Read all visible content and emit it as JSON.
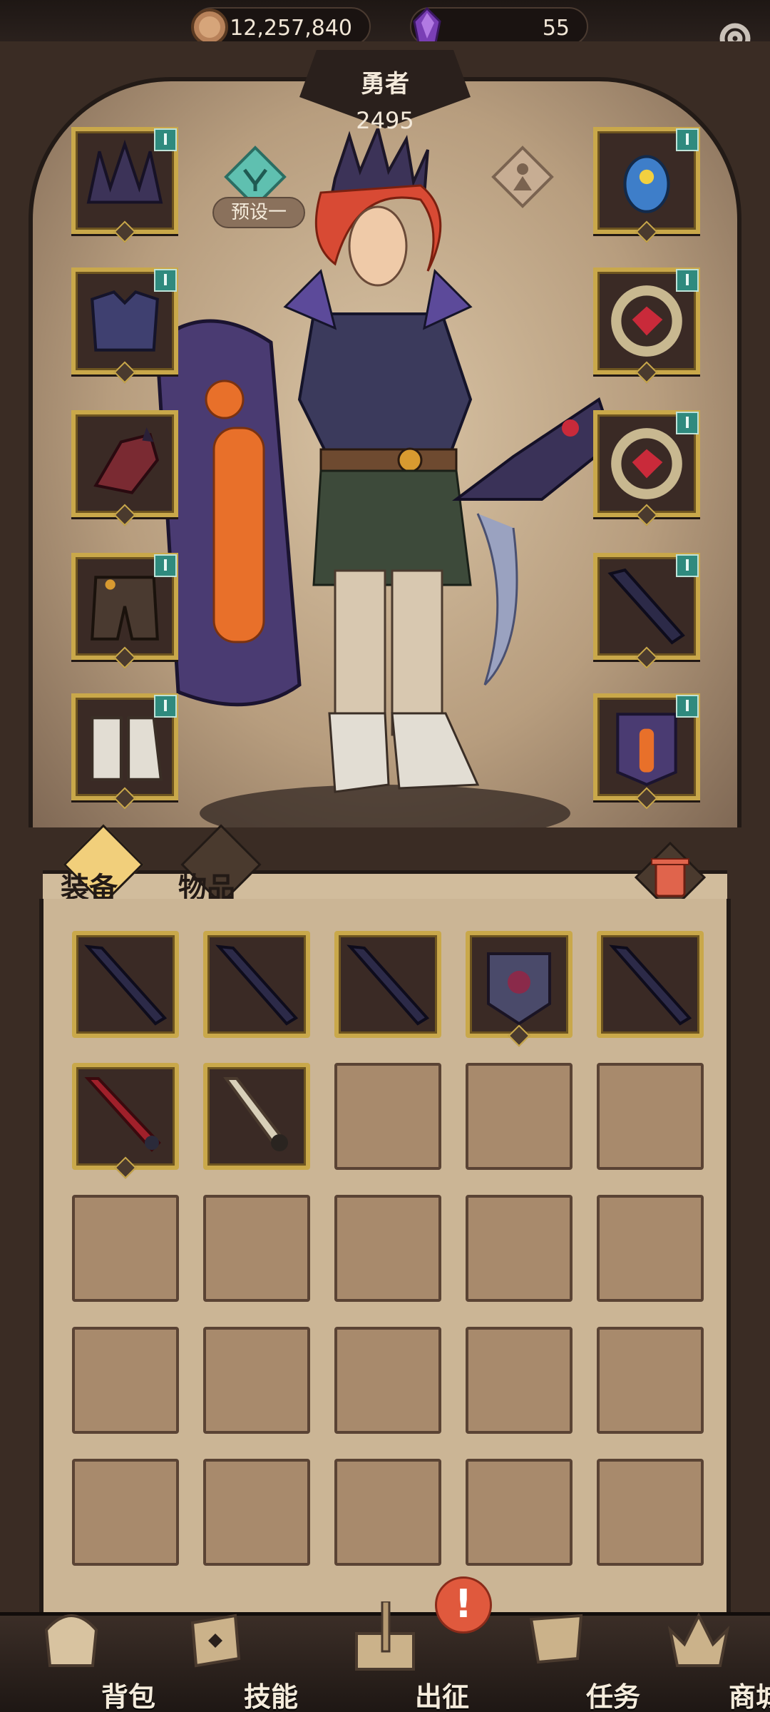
{
  "currency": {
    "gold": "12,257,840",
    "gems": "55"
  },
  "hero": {
    "name": "勇者",
    "power": "2495",
    "preset_label": "预设一"
  },
  "tabs": {
    "equip": "装备",
    "items": "物品"
  },
  "equipment_slots": {
    "left": [
      "helmet",
      "chest-armor",
      "gauntlet",
      "leg-armor",
      "boots"
    ],
    "right": [
      "amulet",
      "ring",
      "ring",
      "main-weapon",
      "off-hand-shield"
    ]
  },
  "inventory": {
    "items": [
      "dark-blade",
      "dark-blade",
      "dark-blade",
      "ornate-shield",
      "dark-blade",
      "crimson-sword",
      "bone-sword"
    ],
    "visible_empty_cells": 18
  },
  "nav": {
    "bag": "背包",
    "skill": "技能",
    "expedition": "出征",
    "quest": "任务",
    "shop": "商城"
  },
  "colors": {
    "frame_gold": "#c9a84a",
    "badge_teal": "#2f8a7e",
    "alert_red": "#e0593d",
    "parchment": "#cbb595"
  }
}
